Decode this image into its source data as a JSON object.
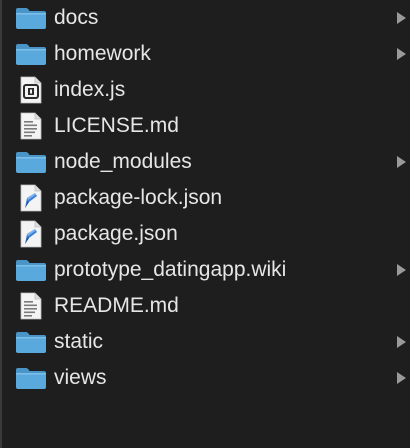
{
  "colors": {
    "background": "#1e1e1e",
    "text": "#e6e6e6",
    "folder": "#5aa9dc",
    "folder_tab": "#4a95c8",
    "chevron": "#9a9a9a"
  },
  "items": [
    {
      "label": "docs",
      "type": "folder",
      "icon": "folder-icon",
      "expandable": true
    },
    {
      "label": "homework",
      "type": "folder",
      "icon": "folder-icon",
      "expandable": true
    },
    {
      "label": "index.js",
      "type": "file",
      "icon": "js-file-icon",
      "expandable": false
    },
    {
      "label": "LICENSE.md",
      "type": "file",
      "icon": "text-file-icon",
      "expandable": false
    },
    {
      "label": "node_modules",
      "type": "folder",
      "icon": "folder-icon",
      "expandable": true
    },
    {
      "label": "package-lock.json",
      "type": "file",
      "icon": "json-file-icon",
      "expandable": false
    },
    {
      "label": "package.json",
      "type": "file",
      "icon": "json-file-icon",
      "expandable": false
    },
    {
      "label": "prototype_datingapp.wiki",
      "type": "folder",
      "icon": "folder-icon",
      "expandable": true
    },
    {
      "label": "README.md",
      "type": "file",
      "icon": "text-file-icon",
      "expandable": false
    },
    {
      "label": "static",
      "type": "folder",
      "icon": "folder-icon",
      "expandable": true
    },
    {
      "label": "views",
      "type": "folder",
      "icon": "folder-icon",
      "expandable": true
    }
  ]
}
